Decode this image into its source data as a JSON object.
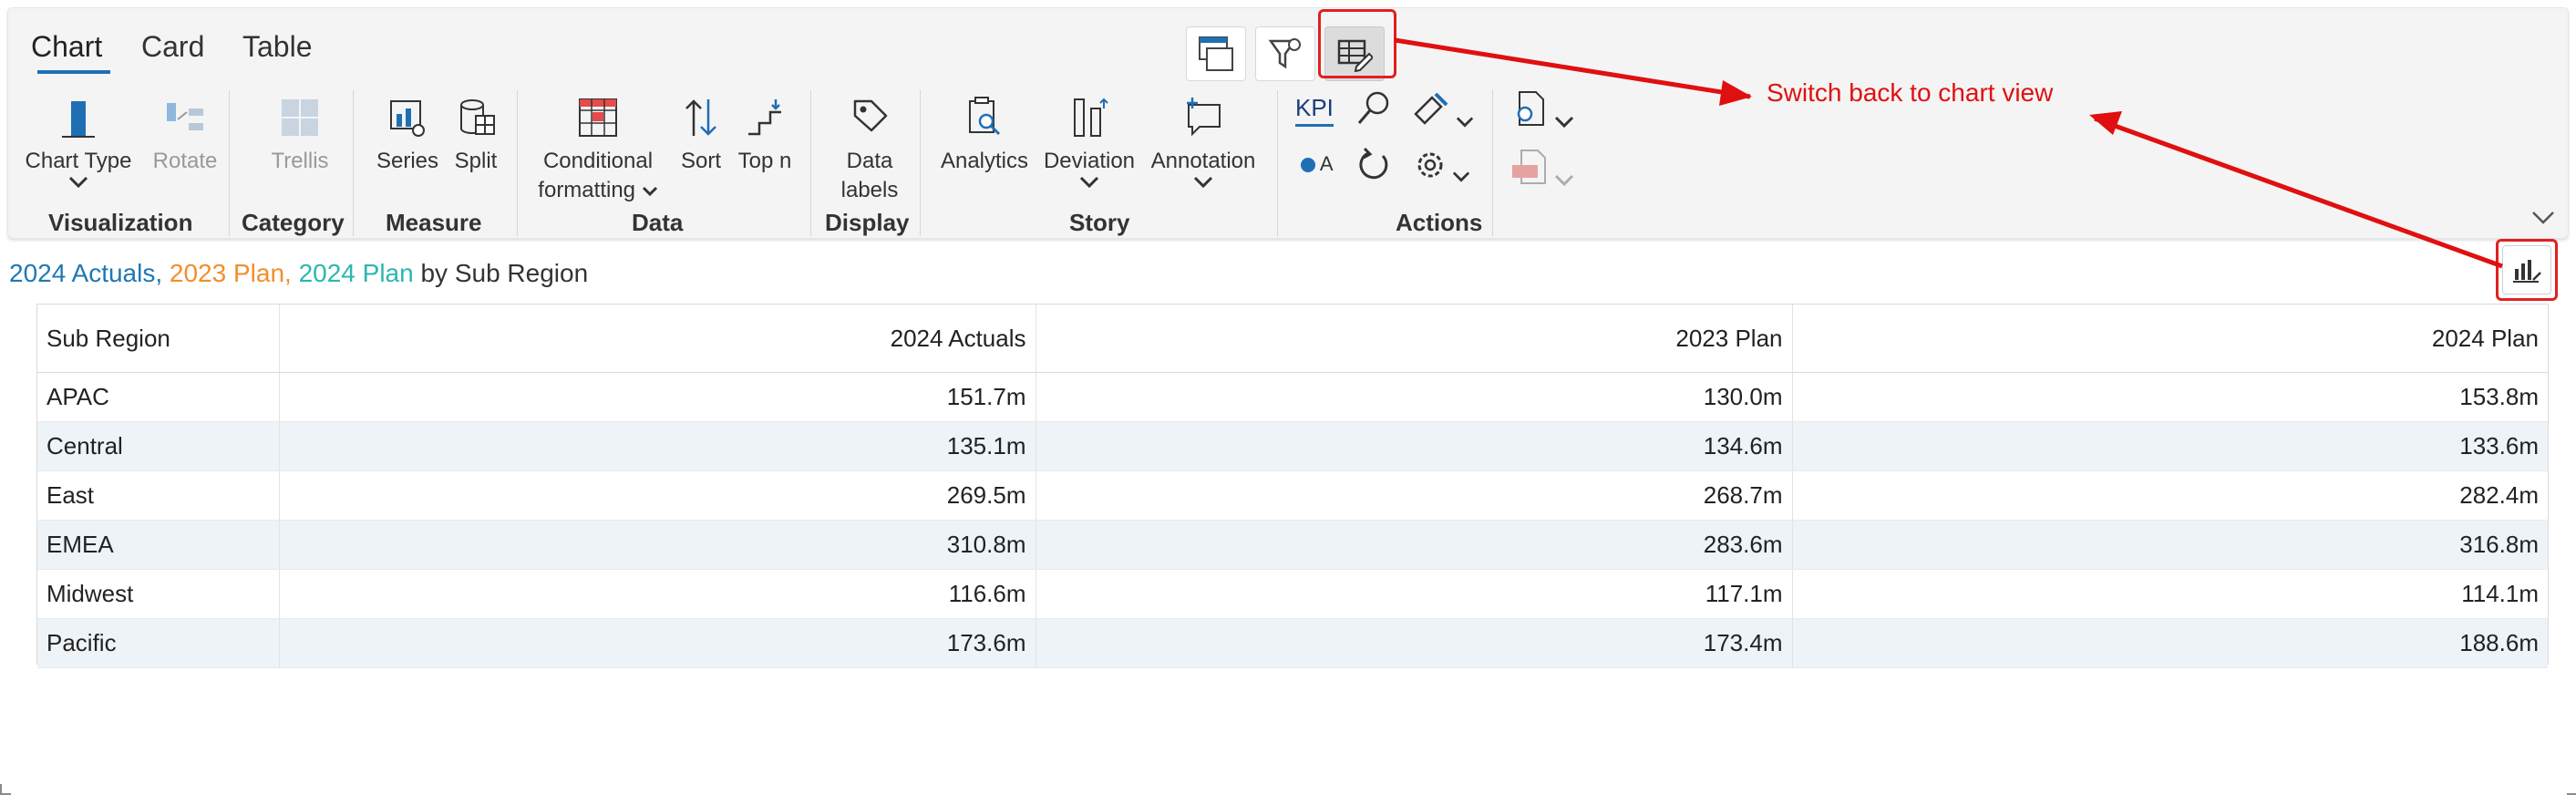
{
  "tabs": [
    {
      "label": "Chart",
      "active": true
    },
    {
      "label": "Card",
      "active": false
    },
    {
      "label": "Table",
      "active": false
    }
  ],
  "view_toggles": [
    {
      "icon": "chart-view-icon",
      "selected": false
    },
    {
      "icon": "filter-icon",
      "selected": false
    },
    {
      "icon": "table-edit-icon",
      "selected": true
    }
  ],
  "toolbar": {
    "chart_type": "Chart Type",
    "rotate": "Rotate",
    "trellis": "Trellis",
    "series": "Series",
    "split": "Split",
    "conditional": "Conditional",
    "formatting": "formatting",
    "sort": "Sort",
    "topn": "Top n",
    "data": "Data",
    "labels": "labels",
    "analytics": "Analytics",
    "deviation": "Deviation",
    "annotation": "Annotation",
    "kpi": "KPI",
    "legend_a": "A"
  },
  "groups": {
    "visualization": "Visualization",
    "category": "Category",
    "measure": "Measure",
    "data": "Data",
    "display": "Display",
    "story": "Story",
    "actions": "Actions"
  },
  "title": {
    "m1": "2024 Actuals,",
    "m2": "2023 Plan,",
    "m3": "2024 Plan",
    "rest": "by Sub Region",
    "colors": {
      "m1": "#1f77b4",
      "m2": "#f28e2b",
      "m3": "#2ab7b0"
    }
  },
  "table": {
    "headers": [
      "Sub Region",
      "2024 Actuals",
      "2023 Plan",
      "2024 Plan"
    ],
    "rows": [
      [
        "APAC",
        "151.7m",
        "130.0m",
        "153.8m"
      ],
      [
        "Central",
        "135.1m",
        "134.6m",
        "133.6m"
      ],
      [
        "East",
        "269.5m",
        "268.7m",
        "282.4m"
      ],
      [
        "EMEA",
        "310.8m",
        "283.6m",
        "316.8m"
      ],
      [
        "Midwest",
        "116.6m",
        "117.1m",
        "114.1m"
      ],
      [
        "Pacific",
        "173.6m",
        "173.4m",
        "188.6m"
      ]
    ]
  },
  "annotation": {
    "text": "Switch back to chart view",
    "color": "#e01010"
  }
}
